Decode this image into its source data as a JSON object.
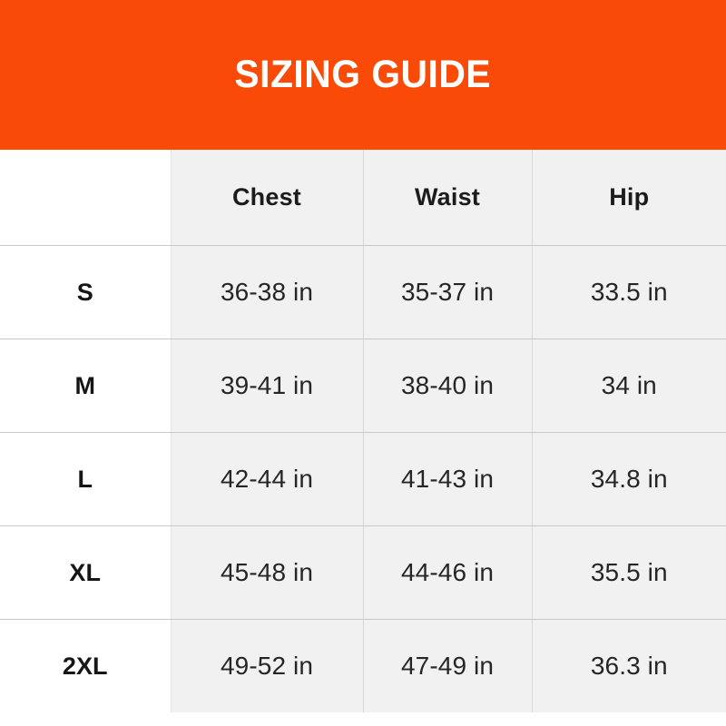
{
  "banner": {
    "title": "SIZING GUIDE",
    "background_color": "#f94b07",
    "text_color": "#ffffff"
  },
  "table": {
    "corner_label": "",
    "columns": [
      "Chest",
      "Waist",
      "Hip"
    ],
    "rows": [
      {
        "size": "S",
        "chest": "36-38 in",
        "waist": "35-37 in",
        "hip": "33.5 in"
      },
      {
        "size": "M",
        "chest": "39-41 in",
        "waist": "38-40 in",
        "hip": "34 in"
      },
      {
        "size": "L",
        "chest": "42-44 in",
        "waist": "41-43 in",
        "hip": "34.8 in"
      },
      {
        "size": "XL",
        "chest": "45-48 in",
        "waist": "44-46 in",
        "hip": "35.5 in"
      },
      {
        "size": "2XL",
        "chest": "49-52 in",
        "waist": "47-49 in",
        "hip": "36.3 in"
      }
    ],
    "cell_background_color": "#f1f1f1",
    "size_column_background_color": "#ffffff",
    "gridline_color": "#c9c9c9"
  }
}
